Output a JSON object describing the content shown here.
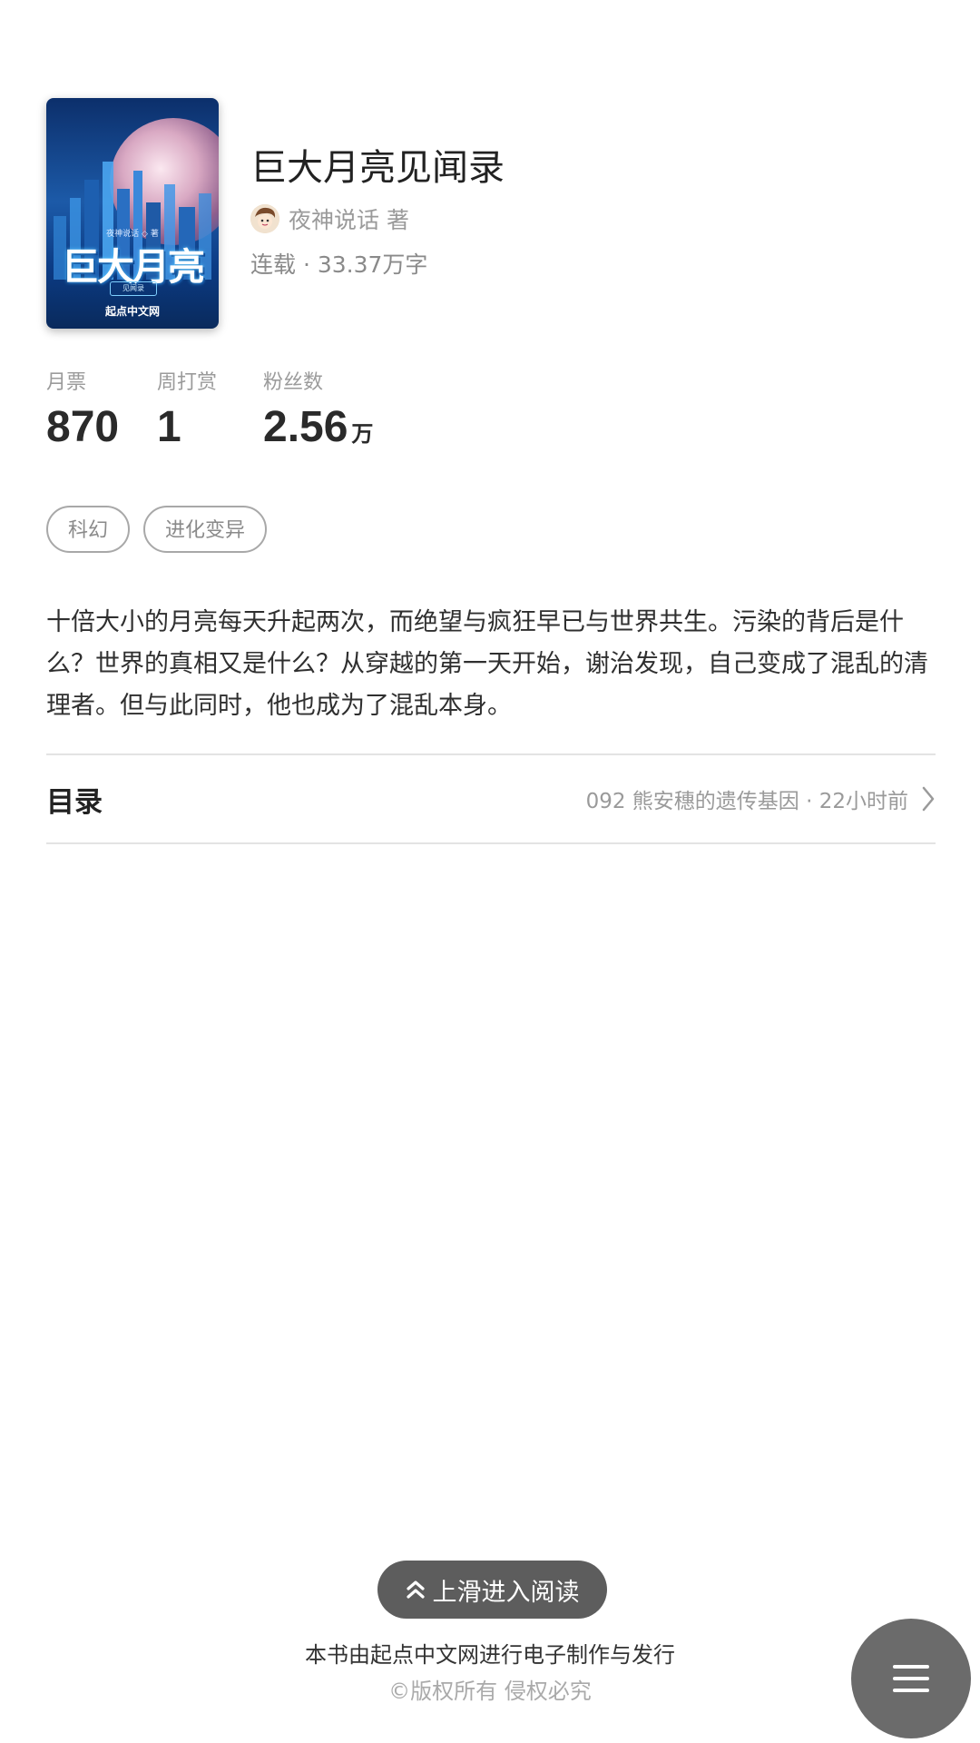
{
  "book": {
    "title": "巨大月亮见闻录",
    "author": "夜神说话 著",
    "meta": "连载 · 33.37万字",
    "cover": {
      "author_line": "夜神说话 ◇ 著",
      "title": "巨大月亮",
      "subtitle": "见闻录",
      "publisher": "起点中文网"
    }
  },
  "stats": [
    {
      "label": "月票",
      "value": "870",
      "unit": ""
    },
    {
      "label": "周打赏",
      "value": "1",
      "unit": ""
    },
    {
      "label": "粉丝数",
      "value": "2.56",
      "unit": "万"
    }
  ],
  "tags": [
    "科幻",
    "进化变异"
  ],
  "synopsis": "十倍大小的月亮每天升起两次，而绝望与疯狂早已与世界共生。污染的背后是什么？世界的真相又是什么？从穿越的第一天开始，谢治发现，自己变成了混乱的清理者。但与此同时，他也成为了混乱本身。",
  "toc": {
    "title": "目录",
    "latest": "092 熊安穗的遗传基因 · 22小时前"
  },
  "read_button": {
    "label": "上滑进入阅读"
  },
  "footer": {
    "line1": "本书由起点中文网进行电子制作与发行",
    "line2": "©版权所有 侵权必究"
  },
  "icons": {
    "toc_arrow": "chevron-right-icon",
    "read_arrow": "double-chevron-up-icon",
    "menu": "menu-icon"
  }
}
